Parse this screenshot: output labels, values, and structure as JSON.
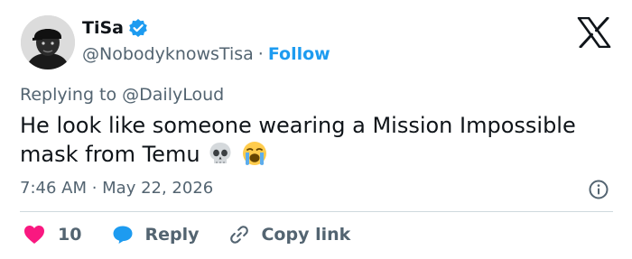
{
  "user": {
    "name": "TiSa",
    "handle": "@NobodyknowsTisa",
    "separator": "·",
    "follow_label": "Follow",
    "verified": true
  },
  "reply_context": {
    "prefix": "Replying to ",
    "target": "@DailyLoud"
  },
  "tweet": {
    "text": "He look like someone wearing a Mission Impossible mask from Temu",
    "emojis": [
      "skull-emoji",
      "loudly-crying-face-emoji"
    ]
  },
  "timestamp": "7:46 AM · May 22, 2026",
  "actions": {
    "like_count": "10",
    "reply_label": "Reply",
    "copy_label": "Copy link"
  },
  "colors": {
    "accent": "#1d9bf0",
    "like": "#f91880",
    "secondary_text": "#536471",
    "primary_text": "#0f1419",
    "divider": "#cfd9de"
  },
  "icons": [
    "verified-badge-icon",
    "x-logo-icon",
    "info-icon",
    "heart-icon",
    "reply-bubble-icon",
    "link-icon"
  ]
}
